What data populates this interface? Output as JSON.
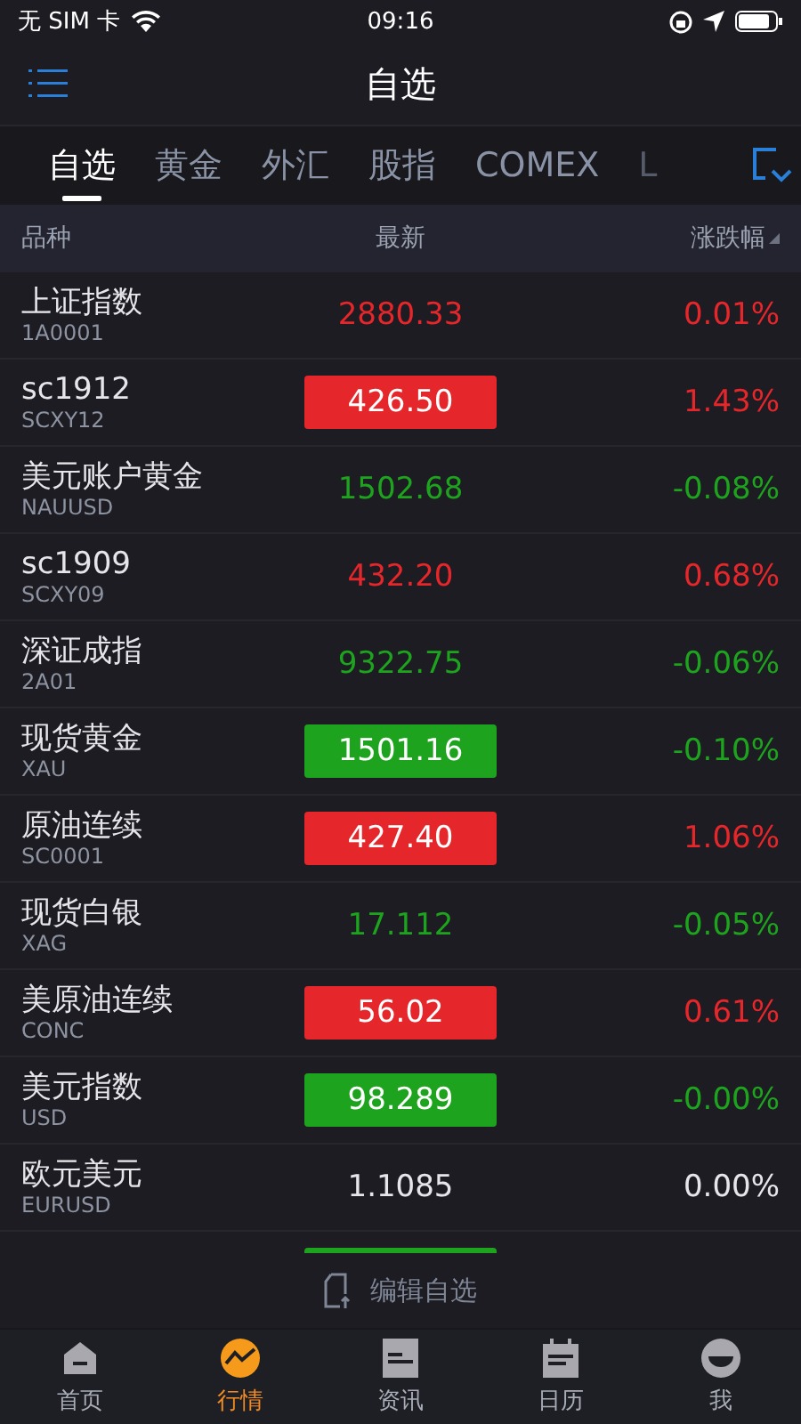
{
  "status_bar": {
    "carrier": "无 SIM 卡",
    "time": "09:16"
  },
  "nav": {
    "title": "自选"
  },
  "tabs": [
    {
      "label": "自选",
      "selected": true
    },
    {
      "label": "黄金",
      "selected": false
    },
    {
      "label": "外汇",
      "selected": false
    },
    {
      "label": "股指",
      "selected": false
    },
    {
      "label": "COMEX",
      "selected": false
    },
    {
      "label": "L",
      "selected": false
    }
  ],
  "table": {
    "columns": [
      "品种",
      "最新",
      "涨跌幅"
    ],
    "rows": [
      {
        "name": "上证指数",
        "code": "1A0001",
        "price": "2880.33",
        "change": "0.01%",
        "color": "#e5262a",
        "highlighted": false
      },
      {
        "name": "sc1912",
        "code": "SCXY12",
        "price": "426.50",
        "change": "1.43%",
        "color": "#e5262a",
        "highlighted": true
      },
      {
        "name": "美元账户黄金",
        "code": "NAUUSD",
        "price": "1502.68",
        "change": "-0.08%",
        "color": "#1ea31e",
        "highlighted": false
      },
      {
        "name": "sc1909",
        "code": "SCXY09",
        "price": "432.20",
        "change": "0.68%",
        "color": "#e5262a",
        "highlighted": false
      },
      {
        "name": "深证成指",
        "code": "2A01",
        "price": "9322.75",
        "change": "-0.06%",
        "color": "#1ea31e",
        "highlighted": false
      },
      {
        "name": "现货黄金",
        "code": "XAU",
        "price": "1501.16",
        "change": "-0.10%",
        "color": "#1ea31e",
        "highlighted": true
      },
      {
        "name": "原油连续",
        "code": "SC0001",
        "price": "427.40",
        "change": "1.06%",
        "color": "#e5262a",
        "highlighted": true
      },
      {
        "name": "现货白银",
        "code": "XAG",
        "price": "17.112",
        "change": "-0.05%",
        "color": "#1ea31e",
        "highlighted": false
      },
      {
        "name": "美原油连续",
        "code": "CONC",
        "price": "56.02",
        "change": "0.61%",
        "color": "#e5262a",
        "highlighted": true
      },
      {
        "name": "美元指数",
        "code": "USD",
        "price": "98.289",
        "change": "-0.00%",
        "color": "#1ea31e",
        "highlighted": true
      },
      {
        "name": "欧元美元",
        "code": "EURUSD",
        "price": "1.1085",
        "change": "0.00%",
        "color": "#e6e6ea",
        "highlighted": false
      },
      {
        "color": "#1ea31e",
        "highlighted": true
      }
    ]
  },
  "edit_bar": {
    "label": "编辑自选"
  },
  "bottom_tabs": [
    {
      "label": "首页",
      "kind": "home",
      "selected": false
    },
    {
      "label": "行情",
      "kind": "market",
      "selected": true
    },
    {
      "label": "资讯",
      "kind": "news",
      "selected": false
    },
    {
      "label": "日历",
      "kind": "calendar",
      "selected": false
    },
    {
      "label": "我",
      "kind": "me",
      "selected": false
    }
  ]
}
